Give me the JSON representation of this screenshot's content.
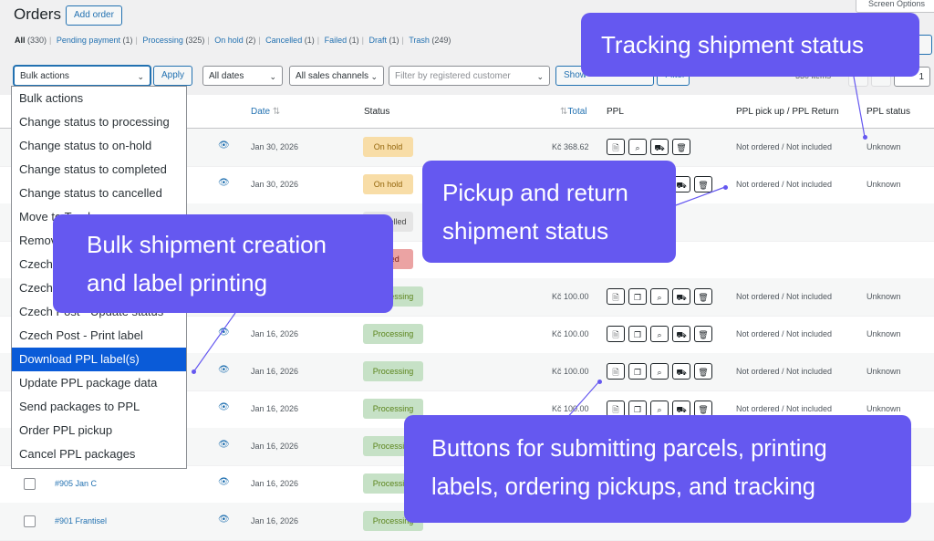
{
  "header": {
    "title": "Orders",
    "add_order": "Add order",
    "screen_options": "Screen Options"
  },
  "views": [
    {
      "label": "All",
      "count": "(330)"
    },
    {
      "label": "Pending payment",
      "count": "(1)"
    },
    {
      "label": "Processing",
      "count": "(325)"
    },
    {
      "label": "On hold",
      "count": "(2)"
    },
    {
      "label": "Cancelled",
      "count": "(1)"
    },
    {
      "label": "Failed",
      "count": "(1)"
    },
    {
      "label": "Draft",
      "count": "(1)"
    },
    {
      "label": "Trash",
      "count": "(249)"
    }
  ],
  "filters": {
    "bulk_actions": "Bulk actions",
    "apply": "Apply",
    "dates": "All dates",
    "channels": "All sales channels",
    "customer_placeholder": "Filter by registered customer",
    "show_button": "Show",
    "filter": "Filter"
  },
  "pagination": {
    "items": "330 items",
    "page": "1"
  },
  "table": {
    "headers": {
      "date": "Date",
      "status": "Status",
      "total": "Total",
      "ppl": "PPL",
      "pickup": "PPL pick up / PPL Return",
      "ppl_status": "PPL status"
    },
    "rows": [
      {
        "order": "",
        "date": "Jan 30, 2026",
        "status": "On hold",
        "total": "Kč 368.62",
        "pickup": "Not ordered / Not included",
        "ppl_status": "Unknown"
      },
      {
        "order": "",
        "date": "Jan 30, 2026",
        "status": "On hold",
        "total": "",
        "pickup": "Not ordered / Not included",
        "ppl_status": "Unknown"
      },
      {
        "order": "",
        "date": "",
        "status": "Cancelled",
        "total": "",
        "pickup": "",
        "ppl_status": ""
      },
      {
        "order": "",
        "date": "",
        "status": "Failed",
        "total": "",
        "pickup": "",
        "ppl_status": ""
      },
      {
        "order": "",
        "date": "",
        "status": "Processing",
        "total": "Kč 100.00",
        "pickup": "Not ordered / Not included",
        "ppl_status": "Unknown"
      },
      {
        "order": "",
        "date": "Jan 16, 2026",
        "status": "Processing",
        "total": "Kč 100.00",
        "pickup": "Not ordered / Not included",
        "ppl_status": "Unknown"
      },
      {
        "order": "",
        "date": "Jan 16, 2026",
        "status": "Processing",
        "total": "Kč 100.00",
        "pickup": "Not ordered / Not included",
        "ppl_status": "Unknown"
      },
      {
        "order": "",
        "date": "Jan 16, 2026",
        "status": "Processing",
        "total": "Kč 100.00",
        "pickup": "Not ordered / Not included",
        "ppl_status": "Unknown"
      },
      {
        "order": "",
        "date": "Jan 16, 2026",
        "status": "Processing",
        "total": "",
        "pickup": "",
        "ppl_status": ""
      },
      {
        "order": "#905 Jan C",
        "date": "Jan 16, 2026",
        "status": "Processing",
        "total": "",
        "pickup": "",
        "ppl_status": ""
      },
      {
        "order": "#901 Frantisel",
        "date": "Jan 16, 2026",
        "status": "Processing",
        "total": "",
        "pickup": "",
        "ppl_status": ""
      }
    ]
  },
  "dropdown": {
    "items": [
      "Bulk actions",
      "Change status to processing",
      "Change status to on-hold",
      "Change status to completed",
      "Change status to cancelled",
      "Move to Trash",
      "Remove personal data",
      "Czech Post - Submit",
      "Czech Post - Cancel",
      "Czech Post - Update status",
      "Czech Post - Print label",
      "Download PPL label(s)",
      "Update PPL package data",
      "Send packages to PPL",
      "Order PPL pickup",
      "Cancel PPL packages"
    ],
    "selected_index": 11
  },
  "callouts": {
    "tracking": "Tracking shipment status",
    "pickup_line1": "Pickup and return",
    "pickup_line2": "shipment status",
    "bulk_line1": "Bulk shipment creation",
    "bulk_line2": "and label printing",
    "buttons_line1": "Buttons for submitting parcels, printing",
    "buttons_line2": "labels, ordering pickups, and tracking"
  },
  "colors": {
    "callout": "#6558f0",
    "link": "#2271b1",
    "selected": "#0a5bd8"
  },
  "icons": {
    "eye": "eye-icon",
    "ppl_buttons": [
      "document-icon",
      "copy-icon",
      "search-icon",
      "car-icon",
      "trash-icon"
    ]
  }
}
